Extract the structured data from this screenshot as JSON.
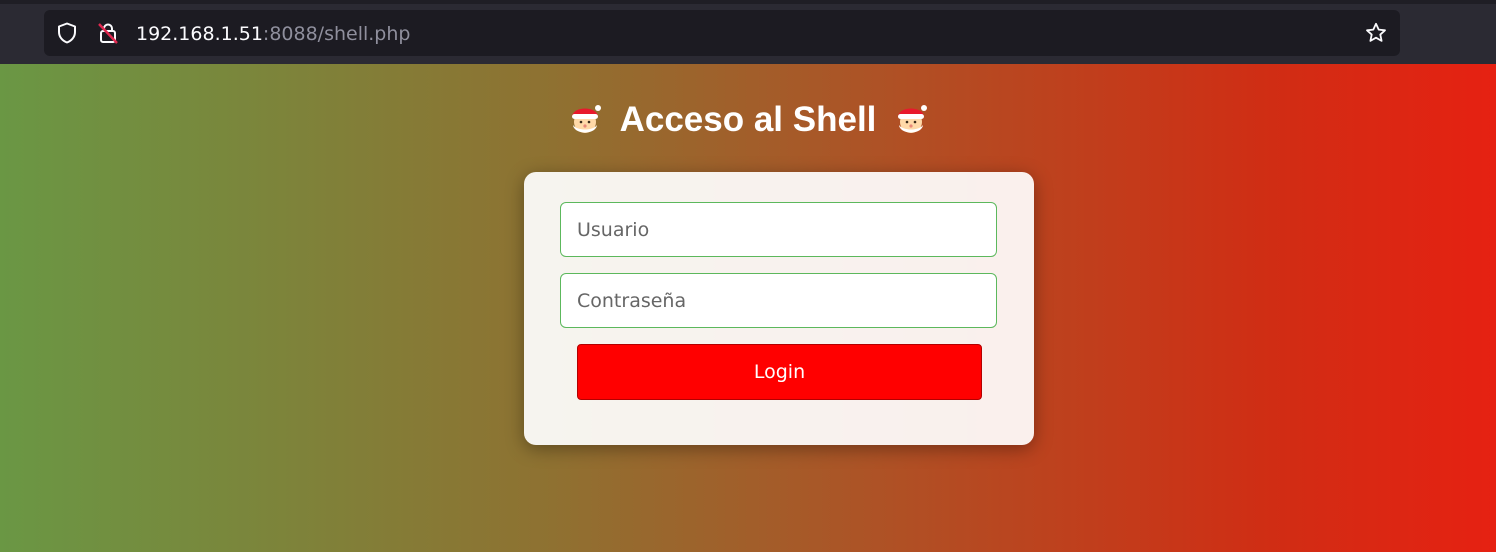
{
  "browser": {
    "url_host": "192.168.1.51",
    "url_rest": ":8088/shell.php",
    "icons": [
      "shield-icon",
      "insecure-lock-icon",
      "bookmark-star-icon"
    ]
  },
  "page": {
    "title": "Acceso al Shell",
    "title_emoji_left": "santa-icon",
    "title_emoji_right": "santa-icon",
    "username_placeholder": "Usuario",
    "password_placeholder": "Contraseña",
    "login_label": "Login"
  },
  "colors": {
    "gradient_left": "#6a9744",
    "gradient_right": "#e62112",
    "login_button": "#ff0000",
    "field_border": "#5cb85c"
  }
}
